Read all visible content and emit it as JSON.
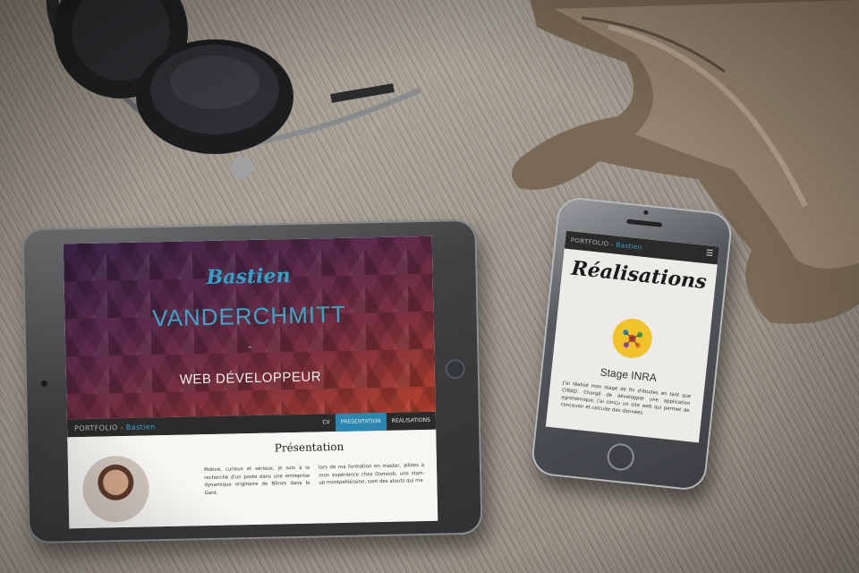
{
  "tablet": {
    "hero": {
      "first_name": "Bastien",
      "last_name": "VANDERCHMITT",
      "separator": "-",
      "role": "WEB DÉVELOPPEUR"
    },
    "nav": {
      "brand_prefix": "PORTFOLIO - ",
      "brand_name": "Bastien",
      "items": [
        {
          "label": "CV",
          "active": false
        },
        {
          "label": "PRESENTATION",
          "active": true
        },
        {
          "label": "REALISATIONS",
          "active": false
        }
      ]
    },
    "presentation": {
      "title": "Présentation",
      "col1": "Motivé, curieux et sérieux, je suis à la recherche d'un poste dans une entreprise dynamique originaire de Nîmes dans le Gard.",
      "col2": "lors de ma formation en master, alliées à mon expérience chez Oomoob, une start-up montpelliéraine, sont des atouts qui me"
    }
  },
  "phone": {
    "nav": {
      "brand_prefix": "PORTFOLIO - ",
      "brand_name": "Bastien",
      "menu_icon": "hamburger-icon"
    },
    "title": "Réalisations",
    "project": {
      "title": "Stage INRA",
      "description": "J'ai réalisé mon stage de fin d'études en tant que CIRAD. Chargé de développer une application agronomique, j'ai conçu un site web qui permet de concevoir et calculer des données"
    }
  },
  "colors": {
    "accent_blue": "#2b86b0",
    "logo_yellow": "#f2c22a",
    "nav_dark": "#2c2b2c"
  }
}
